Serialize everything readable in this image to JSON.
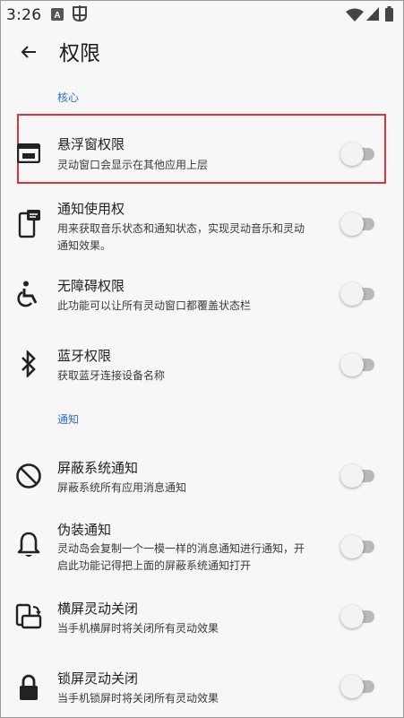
{
  "status_bar": {
    "time": "3:26",
    "icons": [
      "a-notification-icon",
      "bug-notification-icon",
      "wifi-icon",
      "cellular-signal-icon",
      "battery-icon"
    ]
  },
  "app_bar": {
    "title": "权限"
  },
  "sections": [
    {
      "label": "核心",
      "items": [
        {
          "title": "悬浮窗权限",
          "subtitle": "灵动窗口会显示在其他应用上层",
          "icon": "floating-window-icon",
          "enabled": false
        },
        {
          "title": "通知使用权",
          "subtitle_line1": "用来获取音乐状态和通知状态，实现灵动音乐和灵动",
          "subtitle_line2": "通知效果。",
          "icon": "phone-notification-icon",
          "enabled": false
        },
        {
          "title": "无障碍权限",
          "subtitle": "此功能可以让所有灵动窗口都覆盖状态栏",
          "icon": "accessibility-icon",
          "enabled": false
        },
        {
          "title": "蓝牙权限",
          "subtitle": "获取蓝牙连接设备名称",
          "icon": "bluetooth-icon",
          "enabled": false
        }
      ]
    },
    {
      "label": "通知",
      "items": [
        {
          "title": "屏蔽系统通知",
          "subtitle": "屏蔽系统所有应用消息通知",
          "icon": "block-icon",
          "enabled": false
        },
        {
          "title": "伪装通知",
          "subtitle_line1": "灵动岛会复制一个一模一样的消息通知进行通知，开",
          "subtitle_line2": "启此功能记得把上面的屏蔽系统通知打开",
          "icon": "bell-icon",
          "enabled": false
        },
        {
          "title": "横屏灵动关闭",
          "subtitle": "当手机横屏时将关闭所有灵动效果",
          "icon": "screen-rotation-icon",
          "enabled": false
        },
        {
          "title": "锁屏灵动关闭",
          "subtitle": "当手机锁屏时将关闭所有灵动效果",
          "icon": "lock-icon",
          "enabled": false
        }
      ]
    }
  ],
  "colors": {
    "accent": "#2f6fd8",
    "highlight": "#d8343a",
    "toggle_track": "#b9b9b9",
    "background": "#f7f7f7"
  }
}
